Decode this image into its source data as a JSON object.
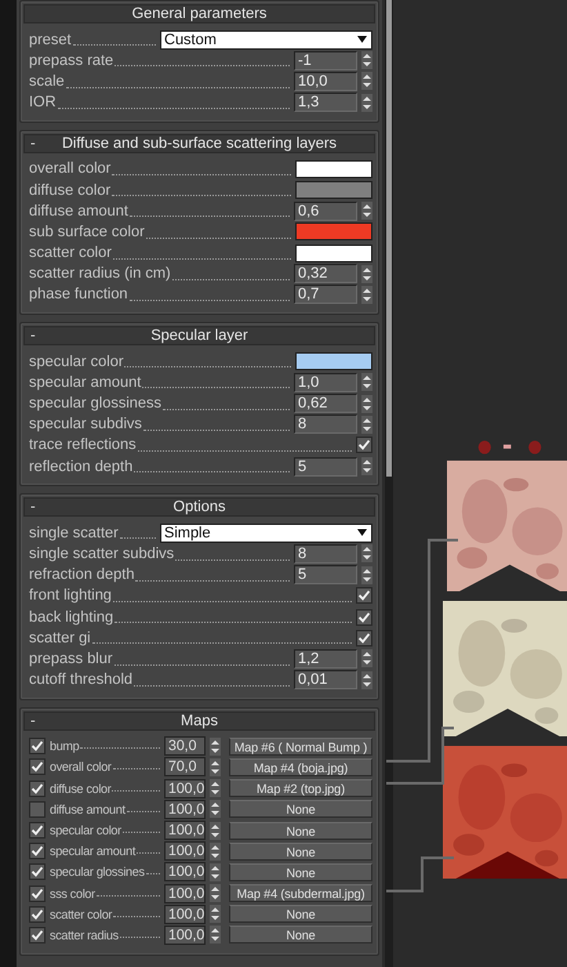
{
  "rollouts": [
    {
      "title": "General parameters",
      "rows": [
        {
          "kind": "dropdown",
          "label": "preset",
          "value": "Custom"
        },
        {
          "kind": "spinner",
          "label": "prepass rate",
          "value": "-1"
        },
        {
          "kind": "spinner",
          "label": "scale",
          "value": "10,0"
        },
        {
          "kind": "spinner",
          "label": "IOR",
          "value": "1,3"
        }
      ]
    },
    {
      "title": "Diffuse and sub-surface scattering layers",
      "sign": "-",
      "rows": [
        {
          "kind": "color",
          "label": "overall color",
          "color": "#ffffff"
        },
        {
          "kind": "color",
          "label": "diffuse color",
          "color": "#7f7f7f"
        },
        {
          "kind": "spinner",
          "label": "diffuse amount",
          "value": "0,6"
        },
        {
          "kind": "color",
          "label": "sub surface color",
          "color": "#ee3a24"
        },
        {
          "kind": "color",
          "label": "scatter color",
          "color": "#ffffff"
        },
        {
          "kind": "spinner",
          "label": "scatter radius (in cm)",
          "value": "0,32"
        },
        {
          "kind": "spinner",
          "label": "phase function",
          "value": "0,7"
        }
      ]
    },
    {
      "title": "Specular layer",
      "sign": "-",
      "rows": [
        {
          "kind": "color",
          "label": "specular color",
          "color": "#a6ccf2"
        },
        {
          "kind": "spinner",
          "label": "specular amount",
          "value": "1,0"
        },
        {
          "kind": "spinner",
          "label": "specular glossiness",
          "value": "0,62"
        },
        {
          "kind": "spinner",
          "label": "specular subdivs",
          "value": "8"
        },
        {
          "kind": "checkbox",
          "label": "trace reflections",
          "checked": true
        },
        {
          "kind": "spinner",
          "label": "reflection depth",
          "value": "5"
        }
      ]
    },
    {
      "title": "Options",
      "sign": "-",
      "rows": [
        {
          "kind": "dropdown",
          "label": "single scatter",
          "value": "Simple"
        },
        {
          "kind": "spinner",
          "label": "single scatter subdivs",
          "value": "8"
        },
        {
          "kind": "spinner",
          "label": "refraction depth",
          "value": "5"
        },
        {
          "kind": "checkbox",
          "label": "front lighting",
          "checked": true
        },
        {
          "kind": "checkbox",
          "label": "back lighting",
          "checked": true
        },
        {
          "kind": "checkbox",
          "label": "scatter gi",
          "checked": true
        },
        {
          "kind": "spinner",
          "label": "prepass blur",
          "value": "1,2"
        },
        {
          "kind": "spinner",
          "label": "cutoff threshold",
          "value": "0,01"
        }
      ]
    },
    {
      "title": "Maps",
      "sign": "-",
      "rows": [
        {
          "kind": "map",
          "checked": true,
          "label": "bump",
          "amount": "30,0",
          "map": "Map #6  ( Normal Bump )"
        },
        {
          "kind": "map",
          "checked": true,
          "label": "overall color",
          "amount": "70,0",
          "map": "Map #4 (boja.jpg)"
        },
        {
          "kind": "map",
          "checked": true,
          "label": "diffuse color",
          "amount": "100,0",
          "map": "Map #2 (top.jpg)"
        },
        {
          "kind": "map",
          "checked": false,
          "label": "diffuse amount",
          "amount": "100,0",
          "map": "None"
        },
        {
          "kind": "map",
          "checked": true,
          "label": "specular color",
          "amount": "100,0",
          "map": "None"
        },
        {
          "kind": "map",
          "checked": true,
          "label": "specular amount",
          "amount": "100,0",
          "map": "None"
        },
        {
          "kind": "map",
          "checked": true,
          "label": "specular glossines",
          "amount": "100,0",
          "map": "None"
        },
        {
          "kind": "map",
          "checked": true,
          "label": "sss color",
          "amount": "100,0",
          "map": "Map #4 (subdermal.jpg)"
        },
        {
          "kind": "map",
          "checked": true,
          "label": "scatter color",
          "amount": "100,0",
          "map": "None"
        },
        {
          "kind": "map",
          "checked": true,
          "label": "scatter radius",
          "amount": "100,0",
          "map": "None"
        }
      ]
    }
  ]
}
